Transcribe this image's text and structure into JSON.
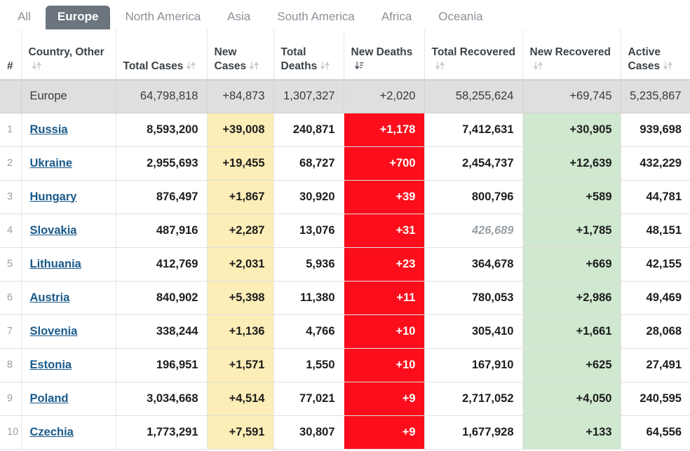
{
  "tabs": [
    {
      "label": "All",
      "active": false
    },
    {
      "label": "Europe",
      "active": true
    },
    {
      "label": "North America",
      "active": false
    },
    {
      "label": "Asia",
      "active": false
    },
    {
      "label": "South America",
      "active": false
    },
    {
      "label": "Africa",
      "active": false
    },
    {
      "label": "Oceania",
      "active": false
    }
  ],
  "table": {
    "headers": [
      {
        "label": "#",
        "sort_icon": "none",
        "key": "num"
      },
      {
        "label": "Country, Other",
        "sort_icon": "sortable",
        "key": "country"
      },
      {
        "label": "Total Cases",
        "sort_icon": "sortable",
        "key": "total_cases"
      },
      {
        "label": "New Cases",
        "sort_icon": "sortable",
        "key": "new_cases"
      },
      {
        "label": "Total Deaths",
        "sort_icon": "sortable",
        "key": "total_deaths"
      },
      {
        "label": "New Deaths",
        "sort_icon": "sorted-desc",
        "key": "new_deaths"
      },
      {
        "label": "Total Recovered",
        "sort_icon": "sortable",
        "key": "total_recovered"
      },
      {
        "label": "New Recovered",
        "sort_icon": "sortable",
        "key": "new_recovered"
      },
      {
        "label": "Active Cases",
        "sort_icon": "sortable",
        "key": "active_cases"
      }
    ],
    "summary_row": {
      "num": "",
      "country": "Europe",
      "total_cases": "64,798,818",
      "new_cases": "+84,873",
      "total_deaths": "1,307,327",
      "new_deaths": "+2,020",
      "total_recovered": "58,255,624",
      "new_recovered": "+69,745",
      "active_cases": "5,235,867"
    },
    "rows": [
      {
        "num": "1",
        "country": "Russia",
        "total_cases": "8,593,200",
        "new_cases": "+39,008",
        "total_deaths": "240,871",
        "new_deaths": "+1,178",
        "total_recovered": "7,412,631",
        "total_recovered_muted": false,
        "new_recovered": "+30,905",
        "active_cases": "939,698"
      },
      {
        "num": "2",
        "country": "Ukraine",
        "total_cases": "2,955,693",
        "new_cases": "+19,455",
        "total_deaths": "68,727",
        "new_deaths": "+700",
        "total_recovered": "2,454,737",
        "total_recovered_muted": false,
        "new_recovered": "+12,639",
        "active_cases": "432,229"
      },
      {
        "num": "3",
        "country": "Hungary",
        "total_cases": "876,497",
        "new_cases": "+1,867",
        "total_deaths": "30,920",
        "new_deaths": "+39",
        "total_recovered": "800,796",
        "total_recovered_muted": false,
        "new_recovered": "+589",
        "active_cases": "44,781"
      },
      {
        "num": "4",
        "country": "Slovakia",
        "total_cases": "487,916",
        "new_cases": "+2,287",
        "total_deaths": "13,076",
        "new_deaths": "+31",
        "total_recovered": "426,689",
        "total_recovered_muted": true,
        "new_recovered": "+1,785",
        "active_cases": "48,151"
      },
      {
        "num": "5",
        "country": "Lithuania",
        "total_cases": "412,769",
        "new_cases": "+2,031",
        "total_deaths": "5,936",
        "new_deaths": "+23",
        "total_recovered": "364,678",
        "total_recovered_muted": false,
        "new_recovered": "+669",
        "active_cases": "42,155"
      },
      {
        "num": "6",
        "country": "Austria",
        "total_cases": "840,902",
        "new_cases": "+5,398",
        "total_deaths": "11,380",
        "new_deaths": "+11",
        "total_recovered": "780,053",
        "total_recovered_muted": false,
        "new_recovered": "+2,986",
        "active_cases": "49,469"
      },
      {
        "num": "7",
        "country": "Slovenia",
        "total_cases": "338,244",
        "new_cases": "+1,136",
        "total_deaths": "4,766",
        "new_deaths": "+10",
        "total_recovered": "305,410",
        "total_recovered_muted": false,
        "new_recovered": "+1,661",
        "active_cases": "28,068"
      },
      {
        "num": "8",
        "country": "Estonia",
        "total_cases": "196,951",
        "new_cases": "+1,571",
        "total_deaths": "1,550",
        "new_deaths": "+10",
        "total_recovered": "167,910",
        "total_recovered_muted": false,
        "new_recovered": "+625",
        "active_cases": "27,491"
      },
      {
        "num": "9",
        "country": "Poland",
        "total_cases": "3,034,668",
        "new_cases": "+4,514",
        "total_deaths": "77,021",
        "new_deaths": "+9",
        "total_recovered": "2,717,052",
        "total_recovered_muted": false,
        "new_recovered": "+4,050",
        "active_cases": "240,595"
      },
      {
        "num": "10",
        "country": "Czechia",
        "total_cases": "1,773,291",
        "new_cases": "+7,591",
        "total_deaths": "30,807",
        "new_deaths": "+9",
        "total_recovered": "1,677,928",
        "total_recovered_muted": false,
        "new_recovered": "+133",
        "active_cases": "64,556"
      }
    ]
  },
  "colors": {
    "tab_active_bg": "#6c757d",
    "new_cases_bg": "#fdeeb8",
    "new_deaths_bg": "#fc0d1b",
    "new_recovered_bg": "#cfe8cf",
    "summary_bg": "#dfdfdf",
    "link": "#1a5a8a"
  }
}
